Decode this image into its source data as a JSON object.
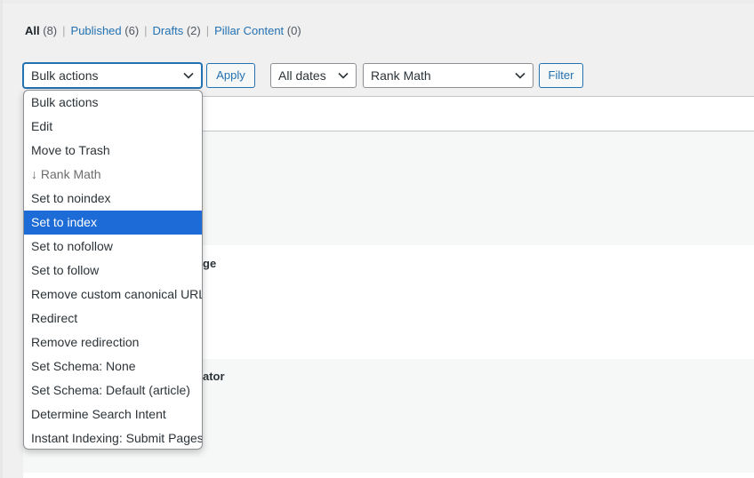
{
  "filters": {
    "all": {
      "label": "All",
      "count": "(8)"
    },
    "published": {
      "label": "Published",
      "count": "(6)"
    },
    "drafts": {
      "label": "Drafts",
      "count": "(2)"
    },
    "pillar": {
      "label": "Pillar Content",
      "count": "(0)"
    },
    "separator": "|"
  },
  "bulk_actions": {
    "selected": "Bulk actions",
    "apply_label": "Apply"
  },
  "dates": {
    "selected": "All dates"
  },
  "seo_filter": {
    "selected": "Rank Math",
    "filter_label": "Filter"
  },
  "table": {
    "row_fragments": [
      "ge",
      "ator"
    ]
  },
  "dropdown": {
    "items": [
      {
        "label": "Bulk actions"
      },
      {
        "label": "Edit"
      },
      {
        "label": "Move to Trash"
      },
      {
        "label": "↓ Rank Math"
      },
      {
        "label": "Set to noindex"
      },
      {
        "label": "Set to index"
      },
      {
        "label": "Set to nofollow"
      },
      {
        "label": "Set to follow"
      },
      {
        "label": "Remove custom canonical URL"
      },
      {
        "label": "Redirect"
      },
      {
        "label": "Remove redirection"
      },
      {
        "label": "Set Schema: None"
      },
      {
        "label": "Set Schema: Default (article)"
      },
      {
        "label": "Determine Search Intent"
      },
      {
        "label": "Instant Indexing: Submit Pages"
      }
    ]
  }
}
